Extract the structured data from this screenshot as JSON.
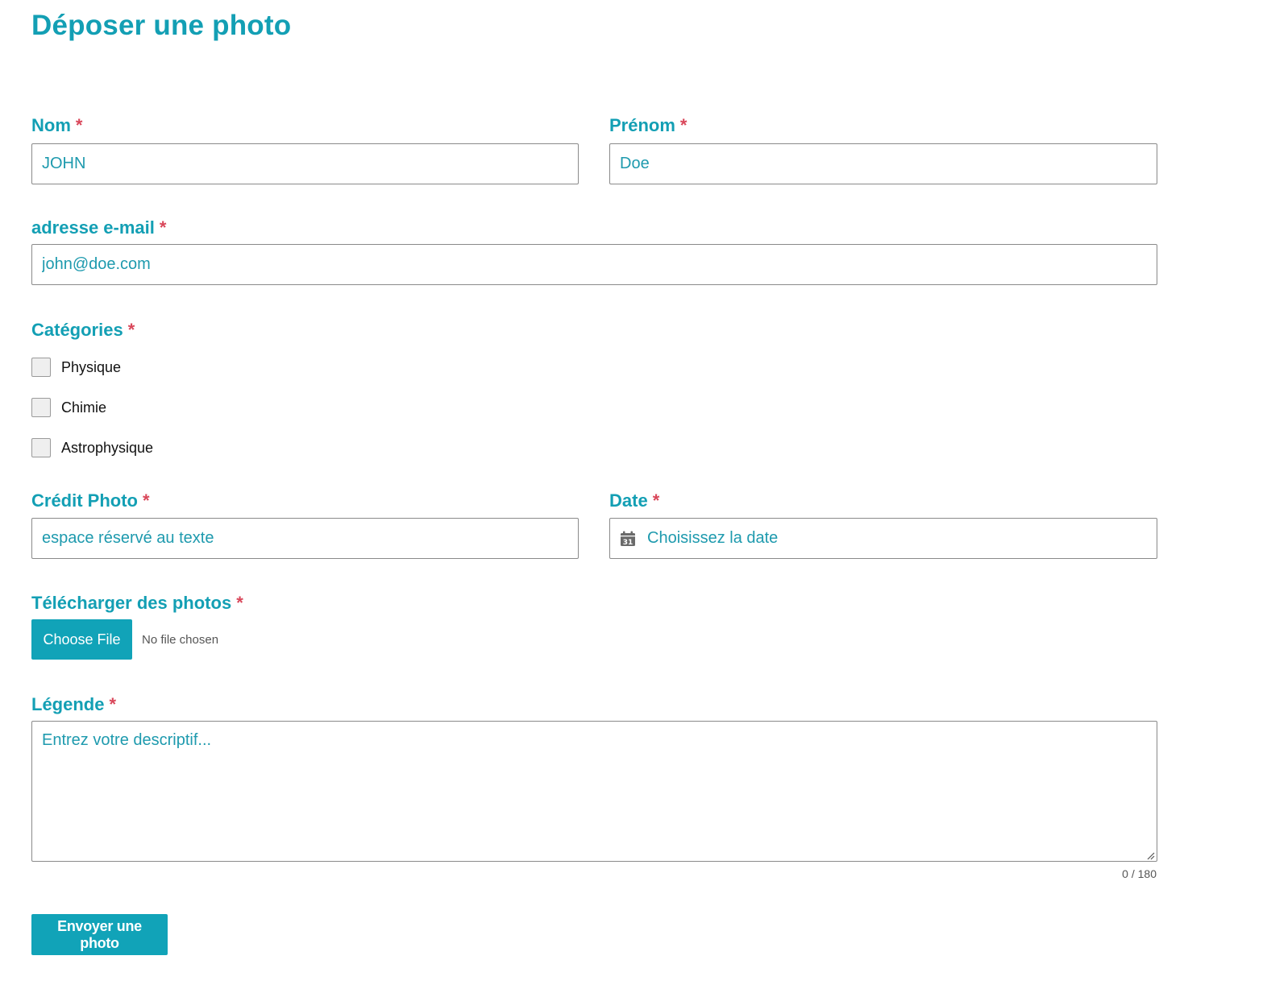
{
  "page_title": "Déposer une photo",
  "required_marker": "*",
  "fields": {
    "nom": {
      "label": "Nom",
      "value": "JOHN"
    },
    "prenom": {
      "label": "Prénom",
      "value": "Doe"
    },
    "email": {
      "label": "adresse e-mail",
      "value": "john@doe.com"
    },
    "categories": {
      "label": "Catégories",
      "options": [
        "Physique",
        "Chimie",
        "Astrophysique"
      ]
    },
    "credit": {
      "label": "Crédit Photo",
      "placeholder": "espace réservé au texte"
    },
    "date": {
      "label": "Date",
      "placeholder": "Choisissez la date",
      "icon": "calendar-icon",
      "icon_day": "31"
    },
    "upload": {
      "label": "Télécharger des photos",
      "button_label": "Choose File",
      "status": "No file chosen"
    },
    "legende": {
      "label": "Légende",
      "placeholder": "Entrez votre descriptif...",
      "counter": "0 / 180"
    }
  },
  "submit_label": "Envoyer une photo",
  "colors": {
    "accent": "#139fb4",
    "required": "#d9475a",
    "button": "#11a3b8"
  }
}
